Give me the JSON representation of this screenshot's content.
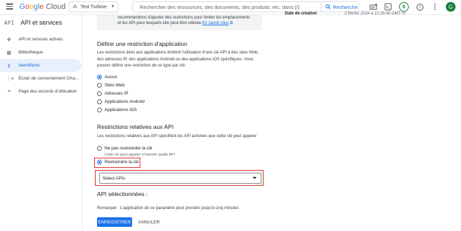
{
  "header": {
    "logo_letters": [
      "G",
      "o",
      "o",
      "g",
      "l",
      "e"
    ],
    "logo_cloud": "Cloud",
    "project_name": "Test Turbine",
    "search_placeholder": "Rechercher des ressources, des documents, des produits, etc. dans (/)",
    "search_button": "Recherche",
    "notification_count": "6",
    "avatar_letter": "G"
  },
  "sidebar": {
    "title_tag": "API",
    "title": "API et services",
    "items": [
      {
        "label": "API et services activés",
        "icon": "diamond-icon"
      },
      {
        "label": "Bibliothèque",
        "icon": "library-icon"
      },
      {
        "label": "Identifiants",
        "icon": "key-icon",
        "active": true
      },
      {
        "label": "Écran de consentement OAu...",
        "icon": "consent-icon"
      },
      {
        "label": "Page des accords d'utilisation",
        "icon": "agreements-icon"
      }
    ]
  },
  "info_box": {
    "line1": "recommandons d'ajouter des restrictions pour limiter les emplacements",
    "line2": "et les API pour lesquels elle peut être utilisée.",
    "link": "En savoir plus"
  },
  "meta": {
    "label": "Date de création",
    "value": "2 février 2024 à 10:26:46 GMT+3"
  },
  "app_restriction": {
    "title": "Définir une restriction d'application",
    "description_lines": [
      "Les restrictions liées aux applications limitent l'utilisation d'une clé API à des sites Web,",
      "des adresses IP, des applications Android ou des applications iOS spécifiques. Vous",
      "pouvez définir une restriction de ce type par clé."
    ],
    "options": [
      "Aucun",
      "Sites Web",
      "Adresses IP",
      "Applications Android",
      "Applications iOS"
    ],
    "selected": "Aucun"
  },
  "api_restriction": {
    "title": "Restrictions relatives aux API",
    "description": "Les restrictions relatives aux API spécifient les API activées que cette clé peut appeler",
    "option_none": "Ne pas restreindre la clé",
    "option_none_hint": "Cette clé peut appeler n'importe quelle API",
    "option_restrict": "Restreindre la clé",
    "selected": "Restreindre la clé",
    "select_value": "Select APIs",
    "selected_title": "API sélectionnées :",
    "remark": "Remarque : L'application de ce paramètre peut prendre jusqu'à cinq minutes"
  },
  "actions": {
    "save": "ENREGISTRER",
    "cancel": "ANNULER"
  },
  "colors": {
    "accent": "#1a73e8",
    "highlight_border": "#d93025",
    "active_nav_bg": "#e8f0fe",
    "badge_green": "#188038"
  }
}
